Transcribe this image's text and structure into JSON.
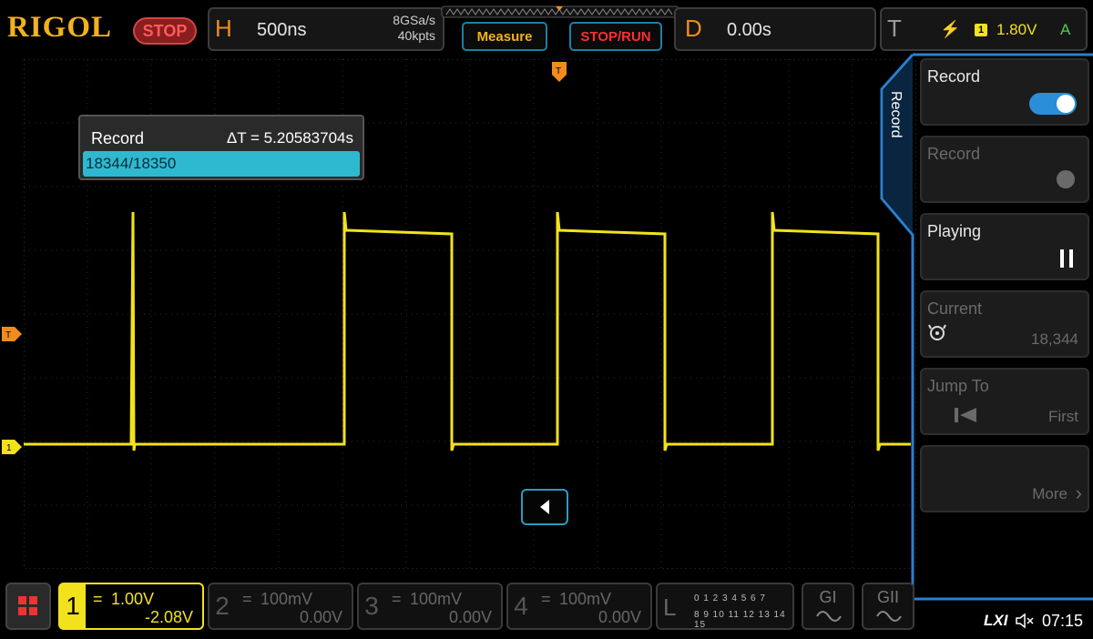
{
  "brand": "RIGOL",
  "run_state": "STOP",
  "horizontal": {
    "letter": "H",
    "timebase": "500ns",
    "sample_rate": "8GSa/s",
    "memory_depth": "40kpts"
  },
  "toolbar": {
    "measure_label": "Measure",
    "stoprun_label": "STOP/RUN"
  },
  "delay": {
    "letter": "D",
    "value": "0.00s"
  },
  "trigger": {
    "letter": "T",
    "source": "1",
    "level": "1.80V",
    "mode": "A"
  },
  "record_popup": {
    "title": "Record",
    "delta_t": "ΔT = 5.20583704s",
    "frame": "18344/18350"
  },
  "menu": {
    "tab_label": "Record",
    "items": [
      {
        "label": "Record",
        "control": "toggle",
        "state": "on"
      },
      {
        "label": "Record",
        "control": "dot",
        "disabled": true
      },
      {
        "label": "Playing",
        "control": "pause"
      },
      {
        "label": "Current",
        "value": "18,344",
        "disabled": true
      },
      {
        "label": "Jump To",
        "value": "First",
        "disabled": true
      },
      {
        "label": "",
        "value": "More",
        "disabled": true
      }
    ]
  },
  "channels": [
    {
      "num": "1",
      "coupling": "=",
      "scale": "1.00V",
      "offset": "-2.08V",
      "active": true,
      "color": "#f2e21c"
    },
    {
      "num": "2",
      "coupling": "=",
      "scale": "100mV",
      "offset": "0.00V",
      "active": false
    },
    {
      "num": "3",
      "coupling": "=",
      "scale": "100mV",
      "offset": "0.00V",
      "active": false
    },
    {
      "num": "4",
      "coupling": "=",
      "scale": "100mV",
      "offset": "0.00V",
      "active": false
    }
  ],
  "logic": {
    "letter": "L",
    "row1": "0 1 2 3  4 5 6 7",
    "row2": "8 9 10 11 12 13 14 15"
  },
  "generators": [
    "GI",
    "GII"
  ],
  "status": {
    "lxi": "LXI",
    "time": "07:15"
  },
  "markers": {
    "trigger_level_tag": "T",
    "channel1_tag": "1",
    "trigger_pos_tag": "T"
  },
  "colors": {
    "accent": "#f2b21c",
    "channel1": "#f2e21c",
    "frame_border": "#2a9bc4",
    "highlight": "#2fb9d0"
  }
}
